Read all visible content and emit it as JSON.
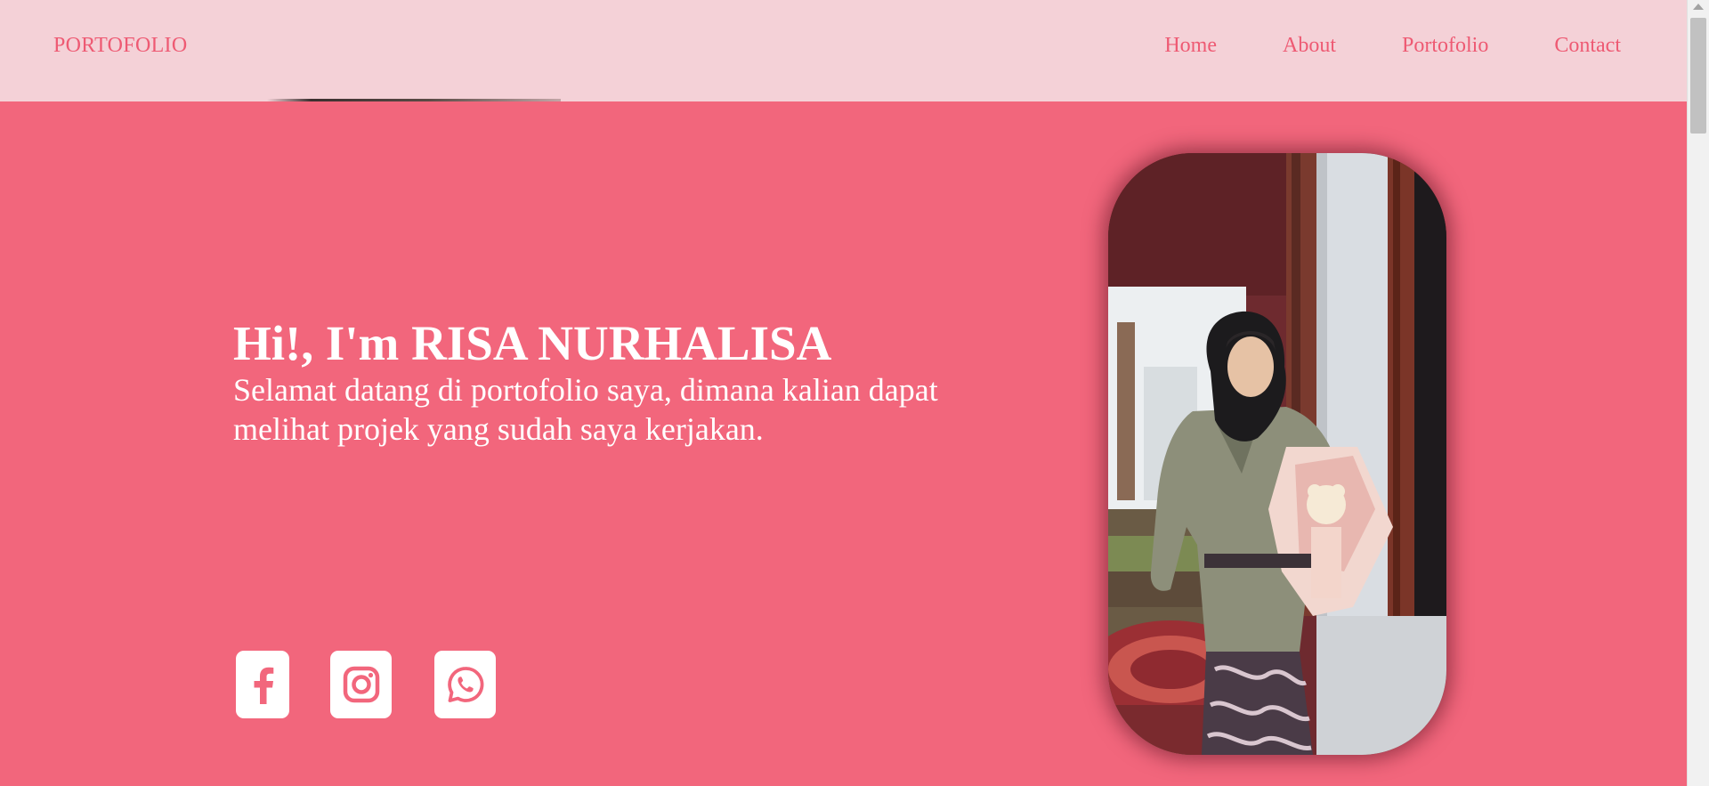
{
  "navbar": {
    "brand": "PORTOFOLIO",
    "links": [
      "Home",
      "About",
      "Portofolio",
      "Contact"
    ]
  },
  "hero": {
    "title": "Hi!, I'm RISA NURHALISA",
    "subtitle": "Selamat datang di portofolio saya, dimana kalian dapat melihat projek yang sudah saya kerjakan."
  },
  "socials": {
    "facebook_icon": "facebook-icon",
    "instagram_icon": "instagram-icon",
    "whatsapp_icon": "whatsapp-icon"
  },
  "colors": {
    "background": "#f2667c",
    "navbar": "#f4d1d7",
    "accent_text": "#ee5a73",
    "icon_tile": "#ffffff"
  }
}
